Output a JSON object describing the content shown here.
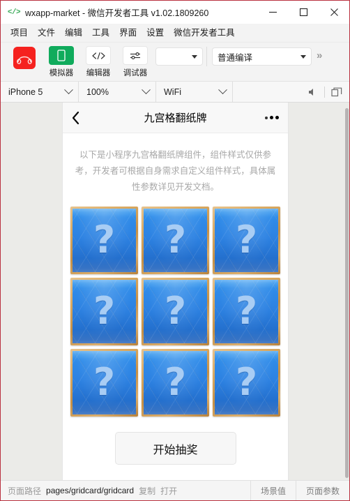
{
  "window": {
    "app_icon": "code-brackets-icon",
    "title": "wxapp-market - 微信开发者工具 v1.02.1809260",
    "minimize_label": "minimize-icon",
    "maximize_label": "maximize-icon",
    "close_label": "close-icon"
  },
  "menubar": {
    "items": [
      {
        "label": "项目"
      },
      {
        "label": "文件"
      },
      {
        "label": "编辑"
      },
      {
        "label": "工具"
      },
      {
        "label": "界面"
      },
      {
        "label": "设置"
      },
      {
        "label": "微信开发者工具"
      }
    ]
  },
  "toolbar": {
    "logo_icon": "wechat-devtools-logo-icon",
    "buttons": [
      {
        "label": "模拟器",
        "icon": "phone-icon"
      },
      {
        "label": "编辑器",
        "icon": "code-icon"
      },
      {
        "label": "调试器",
        "icon": "sliders-icon"
      }
    ],
    "env_select": {
      "value": "",
      "caret": "chevron-down-icon"
    },
    "compile_select": {
      "value": "普通编译",
      "caret": "chevron-down-icon"
    },
    "overflow_label": "»"
  },
  "devicebar": {
    "device": {
      "value": "iPhone 5",
      "caret": "chevron-down-icon"
    },
    "zoom": {
      "value": "100%",
      "caret": "chevron-down-icon"
    },
    "network": {
      "value": "WiFi",
      "caret": "chevron-down-icon"
    },
    "mute_icon": "speaker-icon",
    "panel_icon": "windows-toggle-icon"
  },
  "simulator": {
    "nav": {
      "back_icon": "back-chevron-icon",
      "title": "九宫格翻纸牌",
      "menu_icon": "more-dots-icon"
    },
    "description": "以下是小程序九宫格翻纸牌组件，组件样式仅供参考，开发者可根据自身需求自定义组件样式，具体属性参数详见开发文档。",
    "grid": {
      "rows": 3,
      "cols": 3,
      "card_face": "?",
      "cards": [
        {
          "face": "?"
        },
        {
          "face": "?"
        },
        {
          "face": "?"
        },
        {
          "face": "?"
        },
        {
          "face": "?"
        },
        {
          "face": "?"
        },
        {
          "face": "?"
        },
        {
          "face": "?"
        },
        {
          "face": "?"
        }
      ]
    },
    "draw_button": {
      "label": "开始抽奖"
    }
  },
  "statusbar": {
    "path_label": "页面路径",
    "path_value": "pages/gridcard/gridcard",
    "copy_label": "复制",
    "open_label": "打开",
    "scene_label": "场景值",
    "params_label": "页面参数"
  },
  "colors": {
    "window_border": "#b9313f",
    "logo_red": "#f5221f",
    "sim_green": "#10ab5c",
    "card_border_gold": "#d9a85f",
    "card_blue": "#2d82e2",
    "card_q_blue": "#a9cdf4"
  }
}
